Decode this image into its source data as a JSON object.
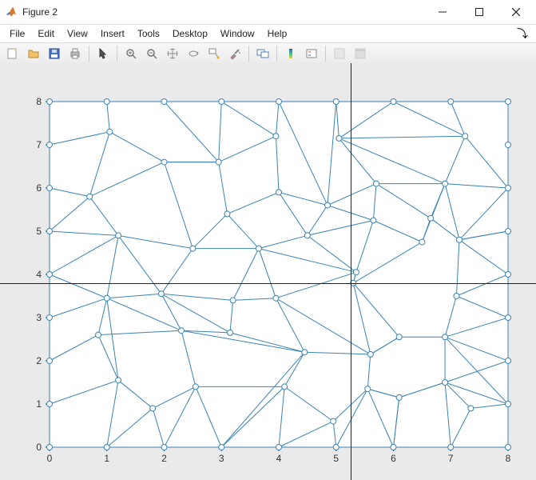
{
  "window": {
    "title": "Figure 2"
  },
  "menus": [
    "File",
    "Edit",
    "View",
    "Insert",
    "Tools",
    "Desktop",
    "Window",
    "Help"
  ],
  "toolbar_icons": [
    "new-figure-icon",
    "open-icon",
    "save-icon",
    "print-icon",
    "pointer-icon",
    "zoom-in-icon",
    "zoom-out-icon",
    "pan-icon",
    "rotate3d-icon",
    "datatip-icon",
    "brush-icon",
    "link-icon",
    "colorbar-icon",
    "legend-icon",
    "hide-tools-icon",
    "dock-icon"
  ],
  "chart_data": {
    "type": "mesh",
    "title": "",
    "xlabel": "",
    "ylabel": "",
    "xlim": [
      0,
      8
    ],
    "ylim": [
      0,
      8
    ],
    "xticks": [
      0,
      1,
      2,
      3,
      4,
      5,
      6,
      7,
      8
    ],
    "yticks": [
      0,
      1,
      2,
      3,
      4,
      5,
      6,
      7,
      8
    ],
    "marker": "o",
    "line_color": "#3a82b5",
    "nodes": [
      [
        0,
        0
      ],
      [
        0,
        1
      ],
      [
        0,
        2
      ],
      [
        0,
        3
      ],
      [
        0,
        4
      ],
      [
        0,
        5
      ],
      [
        0,
        6
      ],
      [
        0,
        7
      ],
      [
        0,
        8
      ],
      [
        1,
        0
      ],
      [
        2,
        0
      ],
      [
        3,
        0
      ],
      [
        4,
        0
      ],
      [
        5,
        0
      ],
      [
        6,
        0
      ],
      [
        7,
        0
      ],
      [
        8,
        0
      ],
      [
        8,
        1
      ],
      [
        8,
        2
      ],
      [
        8,
        3
      ],
      [
        8,
        4
      ],
      [
        8,
        5
      ],
      [
        8,
        6
      ],
      [
        8,
        7
      ],
      [
        8,
        8
      ],
      [
        1,
        8
      ],
      [
        2,
        8
      ],
      [
        3,
        8
      ],
      [
        4,
        8
      ],
      [
        5,
        8
      ],
      [
        6,
        8
      ],
      [
        7,
        8
      ],
      [
        1.0,
        3.45
      ],
      [
        1.95,
        3.55
      ],
      [
        1.2,
        4.9
      ],
      [
        0.7,
        5.8
      ],
      [
        1.05,
        7.3
      ],
      [
        2.0,
        6.6
      ],
      [
        2.5,
        4.6
      ],
      [
        3.1,
        5.4
      ],
      [
        2.95,
        6.6
      ],
      [
        3.95,
        7.2
      ],
      [
        4.0,
        5.9
      ],
      [
        3.65,
        4.6
      ],
      [
        4.5,
        4.9
      ],
      [
        4.85,
        5.6
      ],
      [
        5.05,
        7.15
      ],
      [
        5.7,
        6.1
      ],
      [
        5.65,
        5.25
      ],
      [
        5.35,
        4.05
      ],
      [
        5.3,
        3.8
      ],
      [
        6.5,
        4.75
      ],
      [
        6.65,
        5.3
      ],
      [
        7.15,
        4.8
      ],
      [
        6.9,
        6.1
      ],
      [
        7.25,
        7.2
      ],
      [
        0.85,
        2.6
      ],
      [
        1.2,
        1.55
      ],
      [
        1.8,
        0.9
      ],
      [
        2.55,
        1.4
      ],
      [
        2.3,
        2.7
      ],
      [
        3.15,
        2.65
      ],
      [
        3.2,
        3.4
      ],
      [
        3.95,
        3.45
      ],
      [
        4.45,
        2.2
      ],
      [
        4.1,
        1.4
      ],
      [
        4.95,
        0.6
      ],
      [
        5.55,
        1.35
      ],
      [
        5.6,
        2.15
      ],
      [
        6.1,
        2.55
      ],
      [
        6.9,
        2.55
      ],
      [
        7.1,
        3.5
      ],
      [
        6.9,
        1.5
      ],
      [
        7.35,
        0.9
      ],
      [
        6.1,
        1.15
      ]
    ],
    "edges": [
      [
        0,
        9
      ],
      [
        9,
        10
      ],
      [
        10,
        11
      ],
      [
        11,
        12
      ],
      [
        12,
        13
      ],
      [
        13,
        14
      ],
      [
        14,
        15
      ],
      [
        15,
        16
      ],
      [
        16,
        17
      ],
      [
        17,
        18
      ],
      [
        18,
        19
      ],
      [
        19,
        20
      ],
      [
        20,
        21
      ],
      [
        21,
        22
      ],
      [
        22,
        23
      ],
      [
        23,
        24
      ],
      [
        0,
        1
      ],
      [
        1,
        2
      ],
      [
        2,
        3
      ],
      [
        3,
        4
      ],
      [
        4,
        5
      ],
      [
        5,
        6
      ],
      [
        6,
        7
      ],
      [
        7,
        8
      ],
      [
        8,
        25
      ],
      [
        25,
        26
      ],
      [
        26,
        27
      ],
      [
        27,
        28
      ],
      [
        28,
        29
      ],
      [
        29,
        30
      ],
      [
        30,
        31
      ],
      [
        31,
        24
      ],
      [
        1,
        57
      ],
      [
        57,
        9
      ],
      [
        57,
        58
      ],
      [
        58,
        9
      ],
      [
        58,
        10
      ],
      [
        58,
        59
      ],
      [
        59,
        10
      ],
      [
        59,
        11
      ],
      [
        59,
        65
      ],
      [
        2,
        56
      ],
      [
        56,
        57
      ],
      [
        56,
        32
      ],
      [
        56,
        60
      ],
      [
        57,
        32
      ],
      [
        3,
        32
      ],
      [
        32,
        60
      ],
      [
        60,
        33
      ],
      [
        33,
        32
      ],
      [
        60,
        61
      ],
      [
        61,
        33
      ],
      [
        61,
        62
      ],
      [
        62,
        63
      ],
      [
        62,
        33
      ],
      [
        4,
        32
      ],
      [
        4,
        34
      ],
      [
        34,
        32
      ],
      [
        33,
        34
      ],
      [
        33,
        38
      ],
      [
        34,
        38
      ],
      [
        34,
        35
      ],
      [
        5,
        35
      ],
      [
        5,
        34
      ],
      [
        6,
        35
      ],
      [
        35,
        37
      ],
      [
        35,
        36
      ],
      [
        7,
        36
      ],
      [
        36,
        25
      ],
      [
        36,
        37
      ],
      [
        37,
        38
      ],
      [
        38,
        39
      ],
      [
        37,
        40
      ],
      [
        39,
        40
      ],
      [
        40,
        37
      ],
      [
        26,
        40
      ],
      [
        27,
        40
      ],
      [
        40,
        41
      ],
      [
        27,
        41
      ],
      [
        41,
        42
      ],
      [
        39,
        42
      ],
      [
        38,
        43
      ],
      [
        39,
        43
      ],
      [
        43,
        44
      ],
      [
        42,
        44
      ],
      [
        42,
        45
      ],
      [
        44,
        45
      ],
      [
        28,
        41
      ],
      [
        28,
        45
      ],
      [
        45,
        47
      ],
      [
        44,
        48
      ],
      [
        45,
        48
      ],
      [
        47,
        48
      ],
      [
        48,
        49
      ],
      [
        49,
        50
      ],
      [
        47,
        52
      ],
      [
        48,
        51
      ],
      [
        51,
        52
      ],
      [
        52,
        53
      ],
      [
        52,
        54
      ],
      [
        51,
        54
      ],
      [
        53,
        54
      ],
      [
        53,
        21
      ],
      [
        53,
        22
      ],
      [
        30,
        55
      ],
      [
        31,
        55
      ],
      [
        55,
        22
      ],
      [
        55,
        54
      ],
      [
        46,
        55
      ],
      [
        46,
        54
      ],
      [
        29,
        46
      ],
      [
        46,
        47
      ],
      [
        47,
        54
      ],
      [
        29,
        45
      ],
      [
        30,
        46
      ],
      [
        22,
        54
      ],
      [
        63,
        49
      ],
      [
        63,
        43
      ],
      [
        62,
        43
      ],
      [
        49,
        43
      ],
      [
        50,
        49
      ],
      [
        44,
        49
      ],
      [
        59,
        60
      ],
      [
        60,
        64
      ],
      [
        61,
        64
      ],
      [
        64,
        65
      ],
      [
        65,
        11
      ],
      [
        65,
        66
      ],
      [
        66,
        12
      ],
      [
        12,
        65
      ],
      [
        11,
        64
      ],
      [
        66,
        13
      ],
      [
        66,
        67
      ],
      [
        13,
        67
      ],
      [
        67,
        14
      ],
      [
        67,
        74
      ],
      [
        74,
        67
      ],
      [
        74,
        14
      ],
      [
        67,
        68
      ],
      [
        63,
        64
      ],
      [
        64,
        68
      ],
      [
        68,
        69
      ],
      [
        69,
        70
      ],
      [
        70,
        71
      ],
      [
        71,
        19
      ],
      [
        71,
        53
      ],
      [
        69,
        50
      ],
      [
        50,
        68
      ],
      [
        68,
        63
      ],
      [
        50,
        51
      ],
      [
        69,
        68
      ],
      [
        17,
        73
      ],
      [
        73,
        72
      ],
      [
        72,
        15
      ],
      [
        73,
        15
      ],
      [
        72,
        74
      ],
      [
        72,
        70
      ],
      [
        72,
        17
      ],
      [
        18,
        70
      ],
      [
        70,
        17
      ],
      [
        19,
        70
      ],
      [
        18,
        72
      ],
      [
        20,
        71
      ],
      [
        20,
        53
      ],
      [
        21,
        53
      ],
      [
        74,
        72
      ],
      [
        14,
        74
      ]
    ],
    "crosshair": {
      "x": 5.25,
      "y": 3.8
    }
  }
}
